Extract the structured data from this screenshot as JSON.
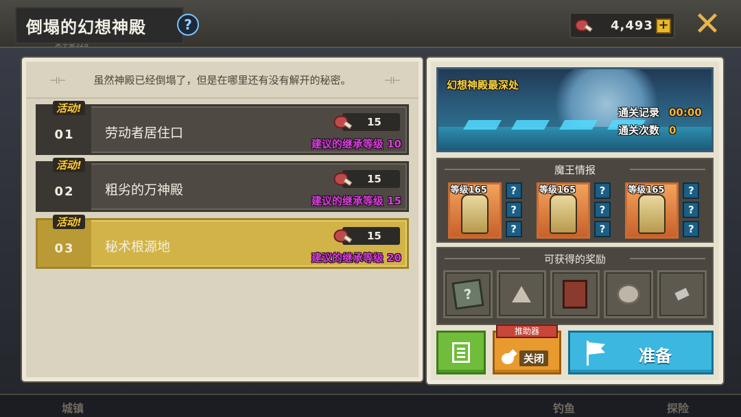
{
  "header": {
    "title": "倒塌的幻想神殿",
    "help_icon": "?",
    "currency_value": "4,493",
    "plus_label": "+",
    "close_label": "✕"
  },
  "background": {
    "ghost_text": "朱宇豪328",
    "bottom_left": "城镇",
    "bottom_mid": "钓鱼",
    "bottom_right": "探险"
  },
  "left": {
    "description": "虽然神殿已经倒塌了，但是在哪里还有没有解开的秘密。",
    "stages": [
      {
        "num": "01",
        "event": "活动!",
        "name": "劳动者居住口",
        "cost": "15",
        "requirement": "建议的继承等级 10",
        "selected": false
      },
      {
        "num": "02",
        "event": "活动!",
        "name": "粗劣的万神殿",
        "cost": "15",
        "requirement": "建议的继承等级 15",
        "selected": false
      },
      {
        "num": "03",
        "event": "活动!",
        "name": "秘术根源地",
        "cost": "15",
        "requirement": "建议的继承等级 20",
        "selected": true
      }
    ]
  },
  "right": {
    "banner_title": "幻想神殿最深处",
    "clear_record_label": "通关记录",
    "clear_record_value": "00:00",
    "clear_count_label": "通关次数",
    "clear_count_value": "0",
    "boss_section_title": "魔王情报",
    "bosses": [
      {
        "level": "等级165",
        "hints": [
          "?",
          "?",
          "?"
        ]
      },
      {
        "level": "等级165",
        "hints": [
          "?",
          "?",
          "?"
        ]
      },
      {
        "level": "等级165",
        "hints": [
          "?",
          "?",
          "?"
        ]
      }
    ],
    "reward_section_title": "可获得的奖励",
    "rewards": [
      {
        "icon": "mystery-book-icon",
        "glyph": "?"
      },
      {
        "icon": "triangle-stone-icon"
      },
      {
        "icon": "red-tome-icon"
      },
      {
        "icon": "round-stone-icon"
      },
      {
        "icon": "metal-ingot-icon"
      }
    ],
    "booster_tag": "推助器",
    "booster_state": "关闭",
    "ready_label": "准备"
  },
  "colors": {
    "selected_stage": "#d2b347",
    "requirement_text": "#d63fd8",
    "ready_button": "#3cb8e0",
    "list_button": "#6fbd3b",
    "booster_button": "#e89a2e"
  }
}
